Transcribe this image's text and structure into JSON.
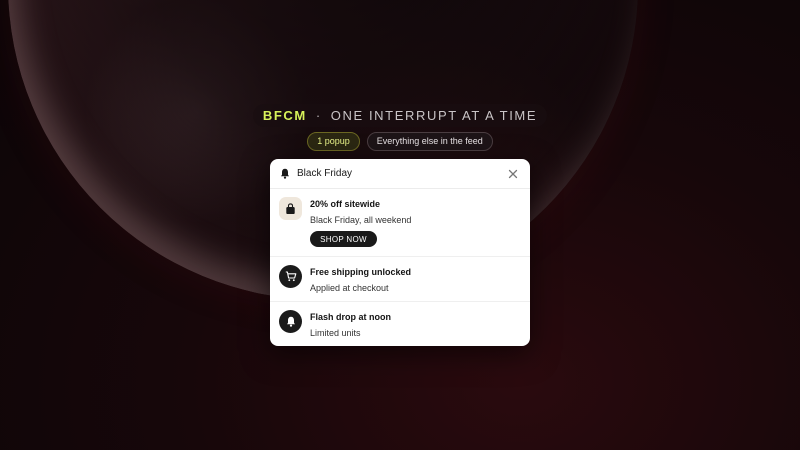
{
  "headline": {
    "brand": "BFCM",
    "separator": "·",
    "tagline": "ONE INTERRUPT AT A TIME"
  },
  "filters": {
    "active": "1 popup",
    "inactive": "Everything else in the feed"
  },
  "popup": {
    "title": "Black Friday",
    "header_icon": "bell-icon",
    "close_icon": "close-icon",
    "items": [
      {
        "icon": "shopping-bag-icon",
        "title": "20% off sitewide",
        "subtitle": "Black Friday, all weekend",
        "action_label": "SHOP NOW"
      },
      {
        "icon": "cart-icon",
        "title": "Free shipping unlocked",
        "subtitle": "Applied at checkout"
      },
      {
        "icon": "bell-icon",
        "title": "Flash drop at noon",
        "subtitle": "Limited units"
      }
    ]
  },
  "colors": {
    "accent_lime": "#d7f25a",
    "background": "#17070a",
    "card": "#ffffff",
    "button": "#1a1a1a"
  }
}
